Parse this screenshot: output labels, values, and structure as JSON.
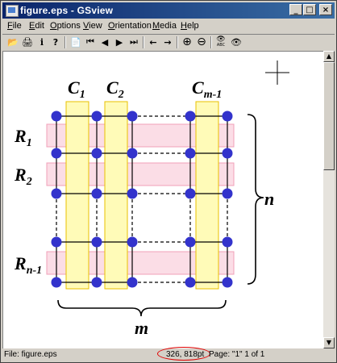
{
  "window": {
    "title": "figure.eps - GSview"
  },
  "title_buttons": {
    "minimize": "_",
    "maximize": "□",
    "close": "×"
  },
  "menu": [
    "File",
    "Edit",
    "Options",
    "View",
    "Orientation",
    "Media",
    "Help"
  ],
  "toolbar": {
    "tools": [
      {
        "name": "open-file-tool",
        "glyph": "📂"
      },
      {
        "name": "print-tool",
        "glyph": "🖨"
      },
      {
        "name": "info-tool",
        "glyph": "i"
      },
      {
        "name": "help-tool",
        "glyph": "?"
      },
      {
        "name": "goto-page-tool",
        "glyph": "📄"
      },
      {
        "name": "first-page-tool",
        "glyph": "⏮"
      },
      {
        "name": "previous-page-tool",
        "glyph": "◀"
      },
      {
        "name": "next-page-tool",
        "glyph": "▶"
      },
      {
        "name": "last-page-tool",
        "glyph": "⏭"
      },
      {
        "name": "back-tool",
        "glyph": "←"
      },
      {
        "name": "forward-tool",
        "glyph": "→"
      },
      {
        "name": "zoom-in-tool",
        "glyph": "⊕"
      },
      {
        "name": "zoom-out-tool",
        "glyph": "⊖"
      },
      {
        "name": "preview-abc-tool",
        "glyph": "👁"
      },
      {
        "name": "preview-tool",
        "glyph": "👁"
      }
    ],
    "abc_label": "ABC"
  },
  "figure": {
    "columns": [
      {
        "main": "C",
        "sub": "1"
      },
      {
        "main": "C",
        "sub": "2"
      },
      {
        "main": "C",
        "sub": "m-1"
      }
    ],
    "rows": [
      {
        "main": "R",
        "sub": "1"
      },
      {
        "main": "R",
        "sub": "2"
      },
      {
        "main": "R",
        "sub": "n-1"
      }
    ],
    "height_label": "n",
    "width_label": "m",
    "colors": {
      "column_fill": "#fffbb8",
      "column_stroke": "#e8c000",
      "row_fill": "#fbdde6",
      "row_stroke": "#f0a0b8",
      "node": "#3333cc",
      "line": "#000000"
    }
  },
  "status": {
    "file": "File: figure.eps",
    "coords": "326, 818pt",
    "page": "Page: \"1\"  1 of 1"
  },
  "colors": {
    "titlebar_start": "#0a246a",
    "titlebar_end": "#3a6ea5",
    "highlight_ring": "#e00000"
  }
}
